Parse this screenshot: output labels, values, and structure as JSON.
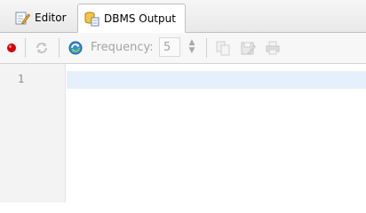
{
  "tabs": [
    {
      "label": "Editor",
      "icon": "edit-icon",
      "active": false
    },
    {
      "label": "DBMS Output",
      "icon": "dbms-output-icon",
      "active": true
    }
  ],
  "toolbar": {
    "buttons": [
      {
        "icon": "record-icon",
        "enabled": true,
        "color": "#d40000"
      },
      {
        "icon": "refresh-icon",
        "enabled": false
      },
      {
        "icon": "auto-refresh-icon",
        "enabled": true
      }
    ],
    "frequency_label": "Frequency:",
    "frequency_value": "5",
    "right_buttons": [
      {
        "icon": "copy-icon",
        "enabled": false
      },
      {
        "icon": "save-icon",
        "enabled": false
      },
      {
        "icon": "print-icon",
        "enabled": false
      }
    ]
  },
  "editor": {
    "line_numbers": [
      "1"
    ],
    "highlight_color": "#e6f0fc"
  }
}
